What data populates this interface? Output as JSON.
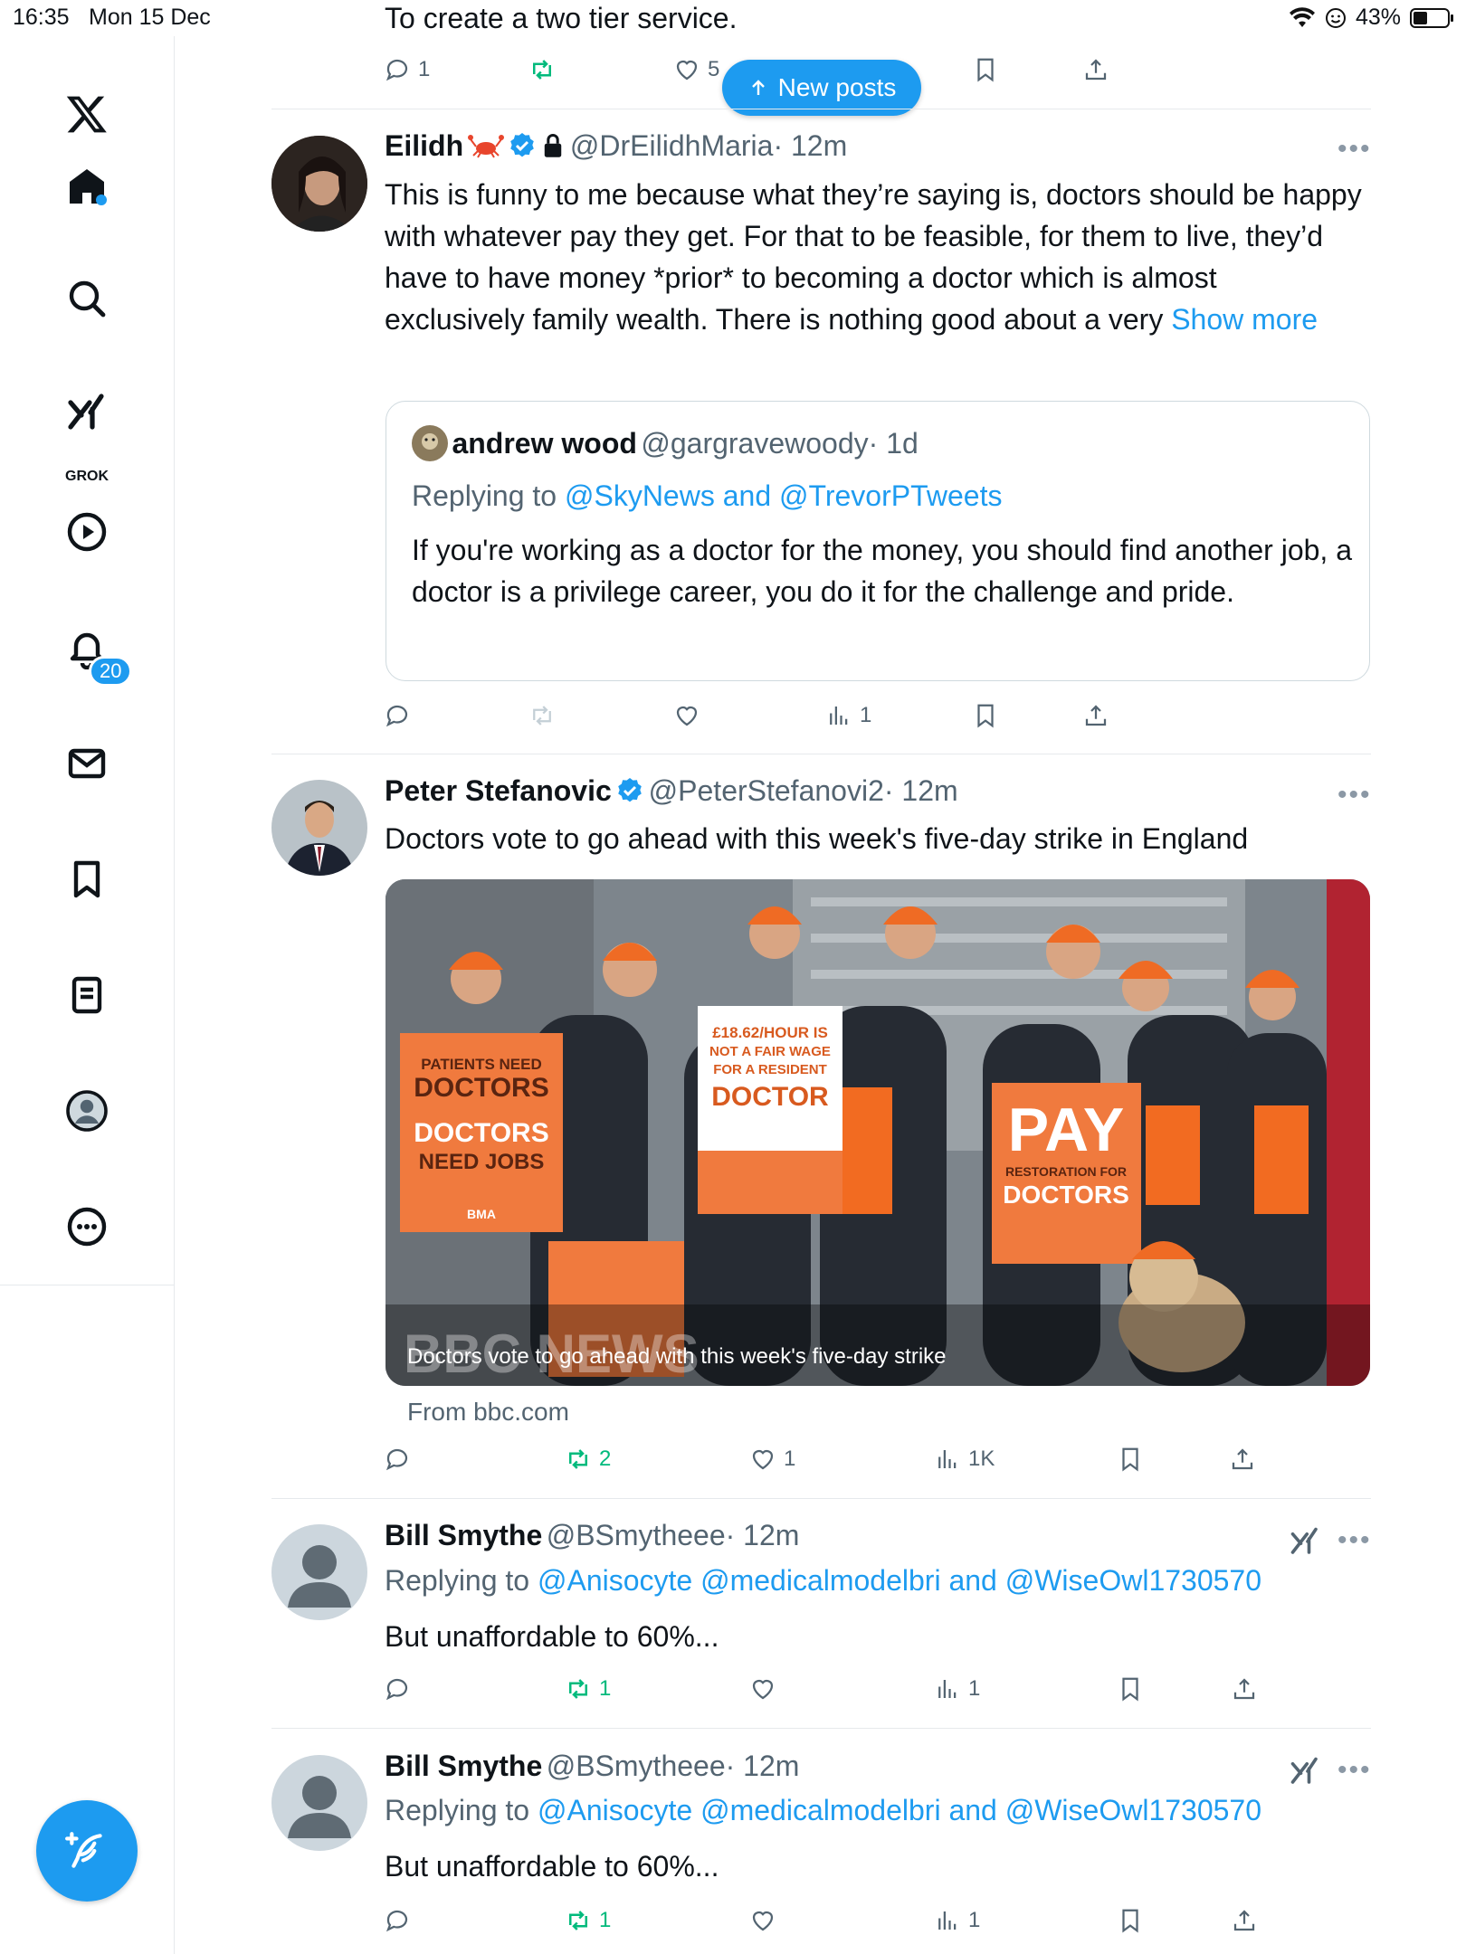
{
  "status_bar": {
    "time": "16:35",
    "date": "Mon 15 Dec",
    "battery": "43%"
  },
  "sidebar": {
    "grok_label": "GROK",
    "notification_count": "20"
  },
  "new_posts_label": "New posts",
  "top_post": {
    "text": "To create a two tier service.",
    "reply_count": "1",
    "like_count": "5"
  },
  "post1": {
    "name": "Eilidh",
    "handle": "@DrEilidhMaria",
    "time": "· 12m",
    "text": "This is funny to me because what they’re saying is, doctors should be happy with whatever pay they get. For that to be feasible, for them to live, they’d have to have money *prior* to becoming a doctor which is almost exclusively family wealth. There is nothing good about a very",
    "show_more": "Show more",
    "views": "1",
    "quote": {
      "name": "andrew wood",
      "handle": "@gargravewoody",
      "time": "· 1d",
      "replying_prefix": "Replying to",
      "replying_to": "@SkyNews and @TrevorPTweets",
      "text": "If you're working as a doctor for the money, you should find another job, a doctor is a privilege career, you do it for the challenge and pride."
    }
  },
  "post2": {
    "name": "Peter Stefanovic",
    "handle": "@PeterStefanovi2",
    "time": "· 12m",
    "text": "Doctors vote to go ahead with this week's five-day strike in England",
    "media_caption": "Doctors vote to go ahead with this week's five-day strike",
    "media_watermark": "BBC NEWS",
    "source": "From bbc.com",
    "retweets": "2",
    "likes": "1",
    "views": "1K",
    "placards": {
      "p1_line1": "PATIENTS NEED",
      "p1_line2": "DOCTORS",
      "p1_line3": "DOCTORS",
      "p1_line4": "NEED JOBS",
      "bma": "BMA",
      "p2_line1": "£18.62/HOUR IS",
      "p2_line2": "NOT A FAIR WAGE",
      "p2_line3": "FOR A RESIDENT",
      "p2_line4": "DOCTOR",
      "p3_line1": "PAY",
      "p3_line2": "RESTORATION FOR",
      "p3_line3": "DOCTORS"
    }
  },
  "post3": {
    "name": "Bill Smythe",
    "handle": "@BSmytheee",
    "time": "· 12m",
    "replying_prefix": "Replying to",
    "replying_to": "@Anisocyte @medicalmodelbri and @WiseOwl1730570",
    "text": "But unaffordable to 60%...",
    "retweets": "1",
    "views": "1"
  },
  "post4": {
    "name": "Bill Smythe",
    "handle": "@BSmytheee",
    "time": "· 12m",
    "replying_prefix": "Replying to",
    "replying_to": "@Anisocyte @medicalmodelbri and @WiseOwl1730570",
    "text": "But unaffordable to 60%...",
    "retweets": "1",
    "views": "1"
  },
  "colors": {
    "accent": "#1d9bf0",
    "retweet": "#00ba7c",
    "muted": "#536471"
  }
}
